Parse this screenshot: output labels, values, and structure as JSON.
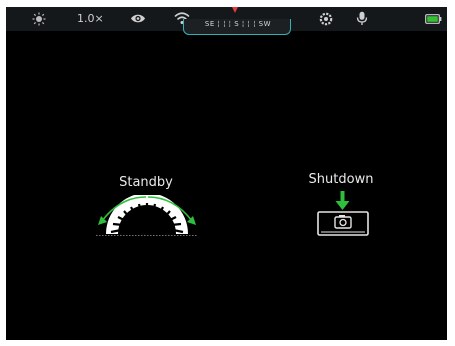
{
  "statusbar": {
    "zoom": "1.0×",
    "icons": [
      "brightness-icon",
      "eye-icon",
      "wifi-icon",
      "settings-icon",
      "microphone-icon",
      "battery-icon"
    ],
    "compass": "SE ¦ ¦ ¦ S ¦ ¦ ¦ SW"
  },
  "standby": {
    "label": "Standby"
  },
  "shutdown": {
    "label": "Shutdown"
  },
  "colors": {
    "accent": "#35b0b3",
    "arrow": "#2fbf3c",
    "battery": "#37c137",
    "marker": "#e23a3a"
  }
}
